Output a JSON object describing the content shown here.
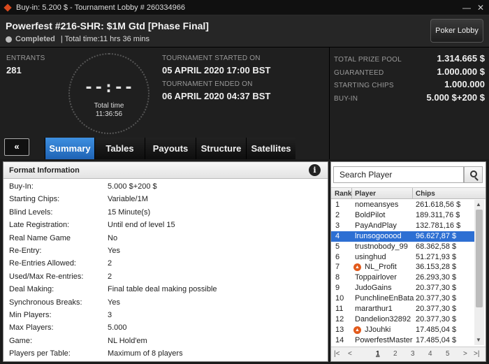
{
  "window": {
    "title": "Buy-in: 5.200 $ - Tournament Lobby # 260334966",
    "minimize_icon": "minimize-icon",
    "close_icon": "close-icon"
  },
  "header": {
    "tournament_name": "Powerfest #216-SHR: $1M Gtd [Phase Final]",
    "status": "Completed",
    "total_time": "| Total time:11 hrs  36 mins",
    "lobby_button": "Poker Lobby"
  },
  "info": {
    "entrants_label": "ENTRANTS",
    "entrants": "281",
    "clock_digits": "--:--",
    "clock_label": "Total time",
    "clock_value": "11:36:56",
    "started_label": "TOURNAMENT STARTED ON",
    "started": "05 APRIL 2020  17:00 BST",
    "ended_label": "TOURNAMENT ENDED ON",
    "ended": "06 APRIL 2020  04:37 BST"
  },
  "prizes": [
    {
      "label": "TOTAL PRIZE POOL",
      "value": "1.314.665 $"
    },
    {
      "label": "GUARANTEED",
      "value": "1.000.000 $"
    },
    {
      "label": "STARTING CHIPS",
      "value": "1.000.000"
    },
    {
      "label": "BUY-IN",
      "value": "5.000 $+200 $"
    }
  ],
  "tabs": {
    "collapse": "«",
    "items": [
      "Summary",
      "Tables",
      "Payouts",
      "Structure",
      "Satellites"
    ],
    "active": "Summary"
  },
  "format": {
    "title": "Format Information",
    "info_icon": "i",
    "rows": [
      {
        "k": "Buy-In:",
        "v": "5.000 $+200 $"
      },
      {
        "k": "Starting Chips:",
        "v": "Variable/1M"
      },
      {
        "k": "Blind Levels:",
        "v": "15 Minute(s)"
      },
      {
        "k": "Late Registration:",
        "v": "Until end of level 15"
      },
      {
        "k": "Real Name Game",
        "v": "No"
      },
      {
        "k": "Re-Entry:",
        "v": "Yes"
      },
      {
        "k": "Re-Entries Allowed:",
        "v": "2"
      },
      {
        "k": "Used/Max Re-entries:",
        "v": "2"
      },
      {
        "k": "Deal Making:",
        "v": "Final table deal making possible"
      },
      {
        "k": "Synchronous Breaks:",
        "v": "Yes"
      },
      {
        "k": "Min Players:",
        "v": "3"
      },
      {
        "k": "Max Players:",
        "v": "5.000"
      },
      {
        "k": "Game:",
        "v": "NL Hold'em"
      },
      {
        "k": "Players per Table:",
        "v": "Maximum of 8 players"
      }
    ]
  },
  "players": {
    "search_placeholder": "Search Player",
    "columns": [
      "Rank",
      "Player",
      "Chips"
    ],
    "rows": [
      {
        "rank": "1",
        "name": "nomeansyes",
        "chips": "261.618,56 $",
        "fox": false
      },
      {
        "rank": "2",
        "name": "BoldPilot",
        "chips": "189.311,76 $",
        "fox": false
      },
      {
        "rank": "3",
        "name": "PayAndPlay",
        "chips": "132.781,16 $",
        "fox": false
      },
      {
        "rank": "4",
        "name": "lrunsogooood",
        "chips": "96.627,87 $",
        "fox": false
      },
      {
        "rank": "5",
        "name": "trustnobody_99",
        "chips": "68.362,58 $",
        "fox": false
      },
      {
        "rank": "6",
        "name": "usinghud",
        "chips": "51.271,93 $",
        "fox": false
      },
      {
        "rank": "7",
        "name": "NL_Profit",
        "chips": "36.153,28 $",
        "fox": true
      },
      {
        "rank": "8",
        "name": "Toppairlover",
        "chips": "26.293,30 $",
        "fox": false
      },
      {
        "rank": "9",
        "name": "JudoGains",
        "chips": "20.377,30 $",
        "fox": false
      },
      {
        "rank": "10",
        "name": "PunchlineEnBata",
        "chips": "20.377,30 $",
        "fox": false
      },
      {
        "rank": "11",
        "name": "mararthur1",
        "chips": "20.377,30 $",
        "fox": false
      },
      {
        "rank": "12",
        "name": "Dandelion32892",
        "chips": "20.377,30 $",
        "fox": false
      },
      {
        "rank": "13",
        "name": "JJouhki",
        "chips": "17.485,04 $",
        "fox": true
      },
      {
        "rank": "14",
        "name": "PowerfestMaster",
        "chips": "17.485,04 $",
        "fox": false
      }
    ],
    "selected_rank": "4",
    "pager": {
      "first": "|<",
      "prev": "<",
      "pages": [
        "1",
        "2",
        "3",
        "4",
        "5"
      ],
      "current": "1",
      "next": ">",
      "last": ">|"
    }
  },
  "colors": {
    "accent": "#2d6fd3",
    "brand": "#d94a1e"
  }
}
